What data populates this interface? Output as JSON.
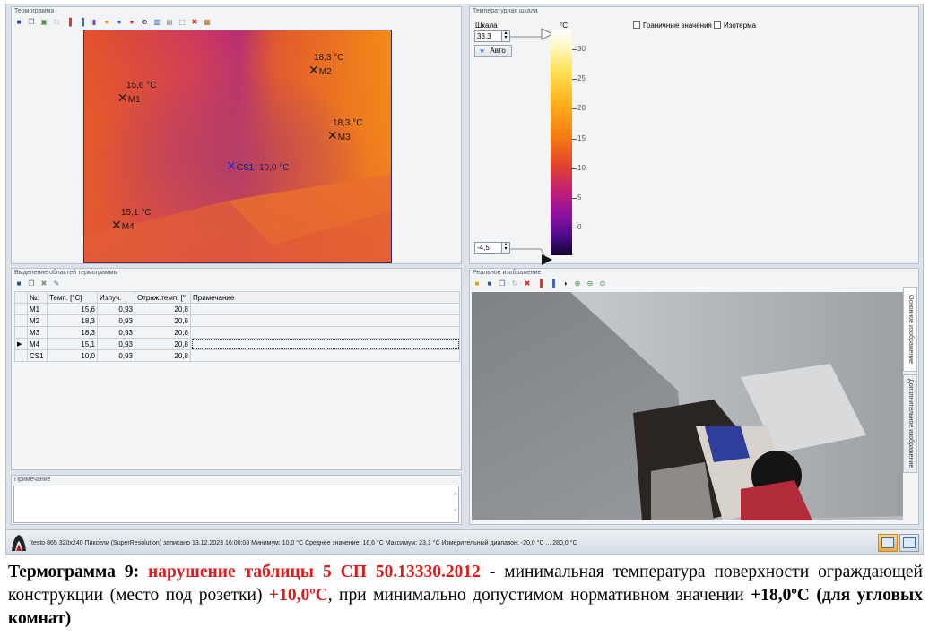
{
  "thermogram": {
    "title": "Термограмма",
    "markers": [
      {
        "id": "M1",
        "temp": "15,6 °C"
      },
      {
        "id": "M2",
        "temp": "18,3 °C"
      },
      {
        "id": "M3",
        "temp": "18,3 °C"
      },
      {
        "id": "M4",
        "temp": "15,1 °C"
      },
      {
        "id": "CS1",
        "temp": "10,0 °C"
      }
    ]
  },
  "scale": {
    "title": "Температурная шкала",
    "label": "Шкала",
    "unit": "°C",
    "max_value": "33,3",
    "min_value": "-4,5",
    "auto_button": "Авто",
    "limit_values_label": "Граничные значения",
    "isotherm_label": "Изотерма",
    "ticks": [
      "30",
      "25",
      "20",
      "15",
      "10",
      "5",
      "0"
    ]
  },
  "regions": {
    "title": "Выделение областей термограммы",
    "columns": [
      "№:",
      "Темп. [°C]",
      "Излуч.",
      "Отраж.темп. [°",
      "Примечание"
    ],
    "rows": [
      [
        "M1",
        "15,6",
        "0,93",
        "20,8",
        ""
      ],
      [
        "M2",
        "18,3",
        "0,93",
        "20,8",
        ""
      ],
      [
        "M3",
        "18,3",
        "0,93",
        "20,8",
        ""
      ],
      [
        "M4",
        "15,1",
        "0,93",
        "20,8",
        ""
      ],
      [
        "CS1",
        "10,0",
        "0,93",
        "20,8",
        ""
      ]
    ]
  },
  "note": {
    "title": "Примечание",
    "value": ""
  },
  "real_image": {
    "title": "Реальное изображение",
    "tab_main": "Основное изображение",
    "tab_additional": "Дополнительное изображение"
  },
  "status": {
    "text": "testo 865 320x240 Пиксели (SuperResolution) записано 13.12.2023 16:00:08 Минимум: 10,0 °C Среднее значение: 16,6 °C Максимум: 23,1 °C Измерительный диапазон: -20,0 °C ... 280,0 °C"
  },
  "caption": {
    "label": "Термограмма  9:",
    "violation": "нарушение таблицы 5 СП 50.13330.2012",
    "text1": " - минимальная температура поверхности ограждающей конструкции (место под розетки) ",
    "min_temp": "+10,0ºС",
    "text2": ", при минимально допустимом нормативном значении ",
    "norm_temp": "+18,0ºС (для угловых комнат)"
  },
  "colors": {
    "accent_red": "#e01b1b",
    "thermal_orange": "#f07a18",
    "thermal_magenta": "#c0356a"
  }
}
